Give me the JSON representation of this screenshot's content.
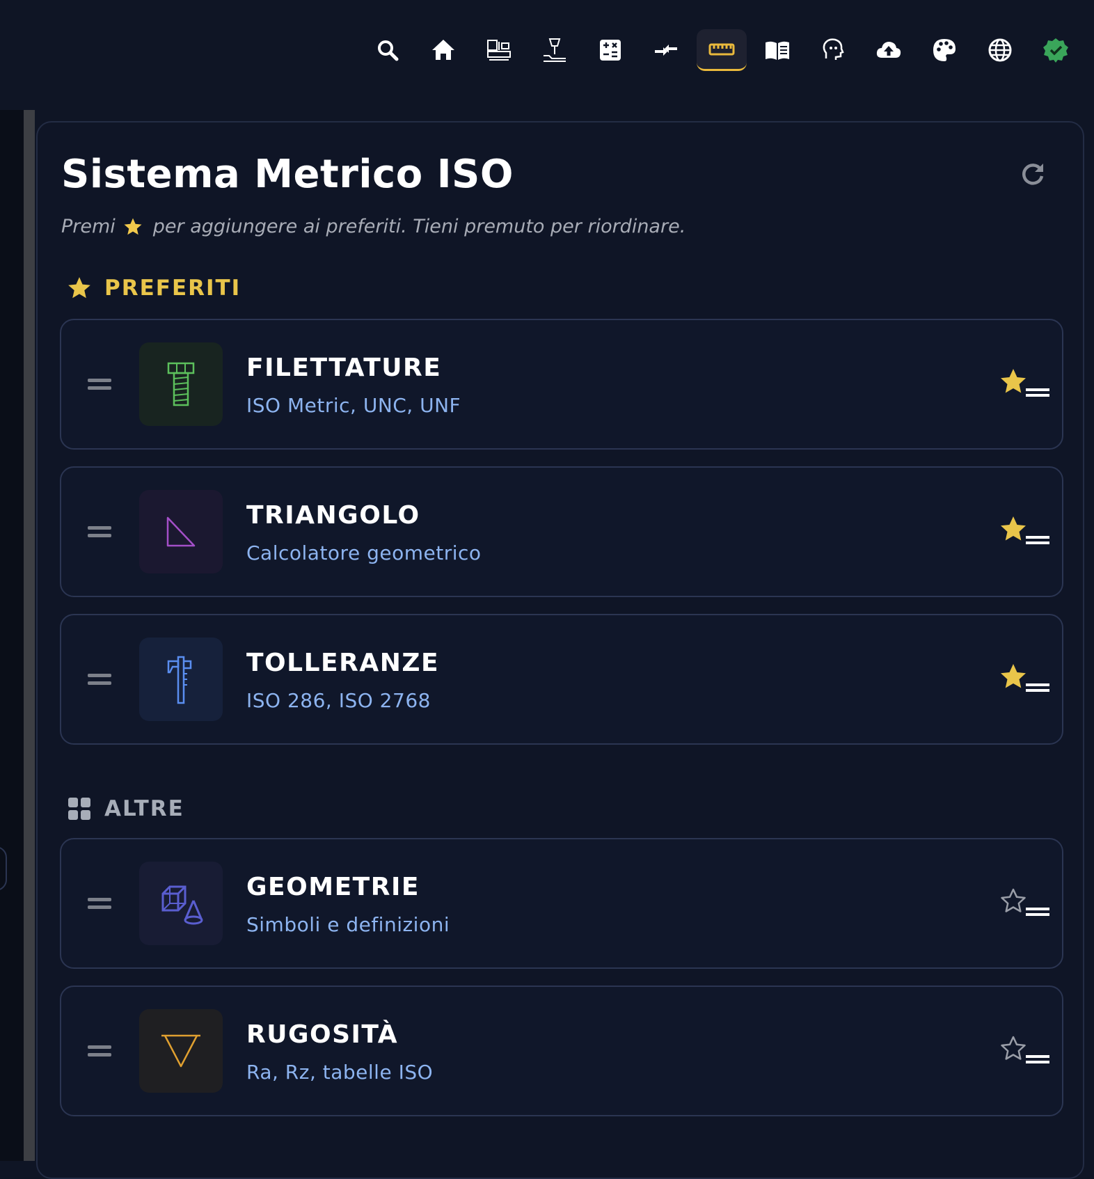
{
  "toolbar": {
    "items": [
      {
        "icon": "search-icon",
        "active": false
      },
      {
        "icon": "home-icon",
        "active": false
      },
      {
        "icon": "machine-panel-icon",
        "active": false
      },
      {
        "icon": "drill-press-icon",
        "active": false
      },
      {
        "icon": "calculator-icon",
        "active": false
      },
      {
        "icon": "compress-arrows-icon",
        "active": false
      },
      {
        "icon": "ruler-icon",
        "active": true
      },
      {
        "icon": "open-book-icon",
        "active": false
      },
      {
        "icon": "head-profile-icon",
        "active": false
      },
      {
        "icon": "cloud-upload-icon",
        "active": false
      },
      {
        "icon": "palette-icon",
        "active": false
      },
      {
        "icon": "globe-icon",
        "active": false
      },
      {
        "icon": "verified-badge-icon",
        "active": false
      }
    ],
    "accent_color": "#e9b93c"
  },
  "page": {
    "title": "Sistema Metrico ISO",
    "hint_before": "Premi",
    "hint_after": "per aggiungere ai preferiti. Tieni premuto per riordinare."
  },
  "sections": {
    "favorites": {
      "label": "PREFERITI",
      "color": "#e9c54a"
    },
    "others": {
      "label": "ALTRE",
      "color": "#a7adb8"
    }
  },
  "cards": [
    {
      "title": "FILETTATURE",
      "subtitle": "ISO Metric, UNC, UNF",
      "icon": "bolt-icon",
      "icon_color": "#5cc05c",
      "tile_color": "#182420",
      "favorite": true
    },
    {
      "title": "TRIANGOLO",
      "subtitle": "Calcolatore geometrico",
      "icon": "right-triangle-icon",
      "icon_color": "#a44fc8",
      "tile_color": "#1b1830",
      "favorite": true
    },
    {
      "title": "TOLLERANZE",
      "subtitle": "ISO 286, ISO 2768",
      "icon": "caliper-icon",
      "icon_color": "#5a8ef0",
      "tile_color": "#16213b",
      "favorite": true
    },
    {
      "title": "GEOMETRIE",
      "subtitle": "Simboli e definizioni",
      "icon": "cube-cone-icon",
      "icon_color": "#5a5ed0",
      "tile_color": "#181c34",
      "favorite": false
    },
    {
      "title": "RUGOSITÀ",
      "subtitle": "Ra, Rz, tabelle ISO",
      "icon": "surface-triangle-icon",
      "icon_color": "#e0a030",
      "tile_color": "#1f1f22",
      "favorite": false
    }
  ],
  "colors": {
    "background": "#0f1525",
    "card_border": "#2b3552",
    "subtitle": "#8db4f0",
    "star_filled": "#e9c54a"
  }
}
